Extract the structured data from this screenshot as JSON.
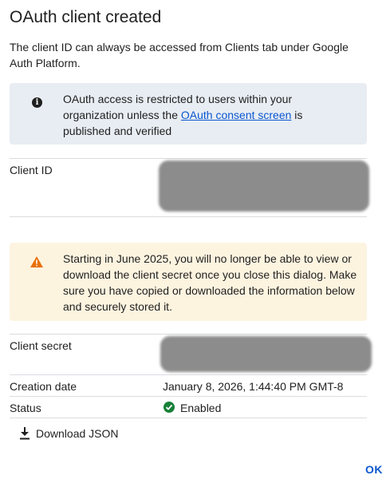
{
  "dialog": {
    "title": "OAuth client created",
    "description": "The client ID can always be accessed from Clients tab under Google Auth Platform."
  },
  "info_banner": {
    "icon": "info-icon",
    "text_before": "OAuth access is restricted to users within your organization unless the ",
    "link_text": "OAuth consent screen",
    "text_after": " is published and verified"
  },
  "client_id": {
    "label": "Client ID"
  },
  "warning_banner": {
    "icon": "warning-icon",
    "text": "Starting in June 2025, you will no longer be able to view or download the client secret once you close this dialog. Make sure you have copied or downloaded the information below and securely stored it."
  },
  "client_secret": {
    "label": "Client secret"
  },
  "creation_date": {
    "label": "Creation date",
    "value": "January 8, 2026, 1:44:40 PM GMT-8"
  },
  "status": {
    "label": "Status",
    "value": "Enabled",
    "color": "#188038"
  },
  "download_button": {
    "label": "Download JSON",
    "icon": "download-icon"
  },
  "ok_button": {
    "label": "OK"
  },
  "colors": {
    "accent": "#0b57d0",
    "info_bg": "#e8edf3",
    "warning_bg": "#fdf4e0",
    "warning_icon": "#e8710a"
  }
}
